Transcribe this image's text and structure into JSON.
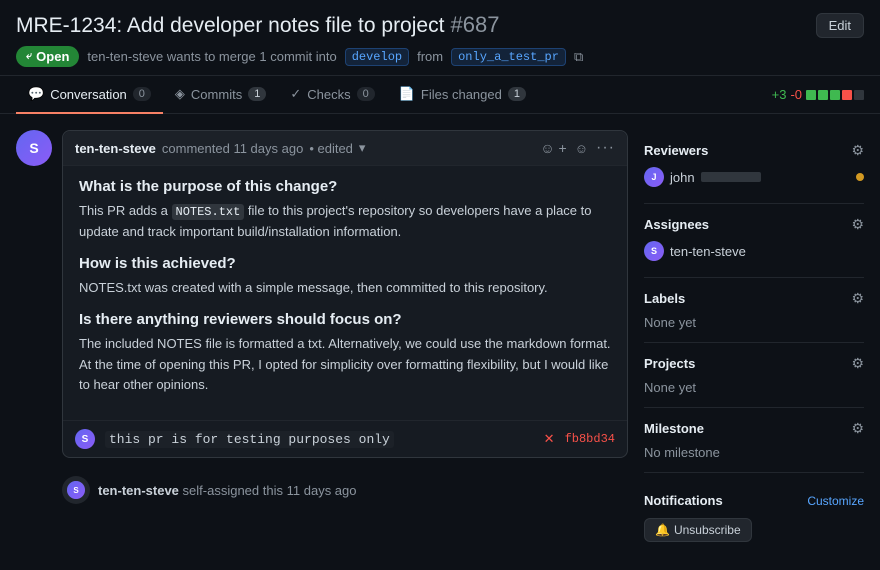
{
  "header": {
    "title": "MRE-1234: Add developer notes file to project",
    "pr_number": "#687",
    "edit_label": "Edit",
    "status": "Open",
    "meta_text": "ten-ten-steve wants to merge 1 commit into",
    "base_branch": "develop",
    "from_text": "from",
    "head_branch": "only_a_test_pr"
  },
  "tabs": [
    {
      "id": "conversation",
      "label": "Conversation",
      "count": "0",
      "icon": "💬",
      "active": true
    },
    {
      "id": "commits",
      "label": "Commits",
      "count": "1",
      "icon": "◈",
      "active": false
    },
    {
      "id": "checks",
      "label": "Checks",
      "count": "0",
      "icon": "✓",
      "active": false
    },
    {
      "id": "files",
      "label": "Files changed",
      "count": "1",
      "icon": "📄",
      "active": false
    }
  ],
  "diff_stats": {
    "add": "+3",
    "remove": "-0",
    "bars": [
      "green",
      "green",
      "green",
      "red",
      "gray"
    ]
  },
  "comment": {
    "author": "ten-ten-steve",
    "time": "commented 11 days ago",
    "edited": "• edited",
    "sections": [
      {
        "heading": "What is the purpose of this change?",
        "body": "This PR adds a NOTES.txt file to this project's repository so developers have a place to update and track important build/installation information."
      },
      {
        "heading": "How is this achieved?",
        "body": "NOTES.txt was created with a simple message, then committed to this repository."
      },
      {
        "heading": "Is there anything reviewers should focus on?",
        "body": "The included NOTES file is formatted a txt. Alternatively, we could use the markdown format. At the time of opening this PR, I opted for simplicity over formatting flexibility, but I would like to hear other opinions."
      }
    ],
    "code_text": "NOTES.txt"
  },
  "commit": {
    "message": "this pr is for testing purposes only",
    "hash": "fb8bd34"
  },
  "event": {
    "user": "ten-ten-steve",
    "action": "self-assigned this",
    "time": "11 days ago"
  },
  "sidebar": {
    "reviewers_title": "Reviewers",
    "reviewers": [
      {
        "name": "john",
        "status": "pending"
      }
    ],
    "assignees_title": "Assignees",
    "assignees": [
      {
        "name": "ten-ten-steve"
      }
    ],
    "labels_title": "Labels",
    "labels_value": "None yet",
    "projects_title": "Projects",
    "projects_value": "None yet",
    "milestone_title": "Milestone",
    "milestone_value": "No milestone",
    "notifications_title": "Notifications",
    "customize_label": "Customize",
    "unsubscribe_label": "Unsubscribe"
  }
}
